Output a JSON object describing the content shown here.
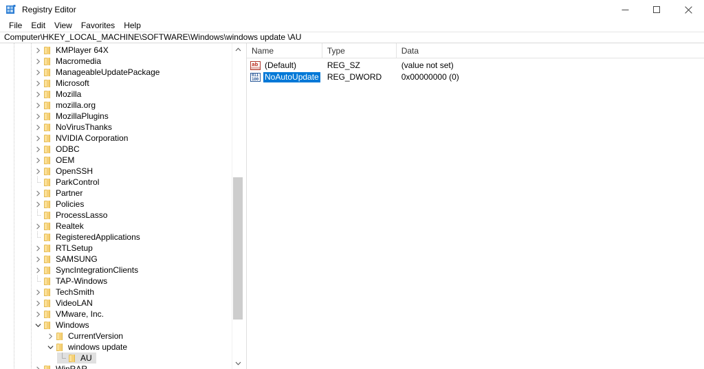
{
  "window": {
    "title": "Registry Editor",
    "icon": "registry-editor-icon",
    "controls": {
      "minimize": "minimize-icon",
      "maximize": "maximize-icon",
      "close": "close-icon"
    }
  },
  "menubar": {
    "items": [
      {
        "label": "File"
      },
      {
        "label": "Edit"
      },
      {
        "label": "View"
      },
      {
        "label": "Favorites"
      },
      {
        "label": "Help"
      }
    ]
  },
  "address": {
    "path": "Computer\\HKEY_LOCAL_MACHINE\\SOFTWARE\\Windows\\windows update \\AU"
  },
  "tree": {
    "scrollbar": {
      "up_icon": "chevron-up-icon",
      "down_icon": "chevron-down-icon",
      "thumb_top_pct": 40.5,
      "thumb_height_pct": 47.0
    },
    "nodes": [
      {
        "label": "KMPlayer 64X",
        "depth": 0,
        "expander": "collapsed",
        "selected": false
      },
      {
        "label": "Macromedia",
        "depth": 0,
        "expander": "collapsed",
        "selected": false
      },
      {
        "label": "ManageableUpdatePackage",
        "depth": 0,
        "expander": "collapsed",
        "selected": false
      },
      {
        "label": "Microsoft",
        "depth": 0,
        "expander": "collapsed",
        "selected": false
      },
      {
        "label": "Mozilla",
        "depth": 0,
        "expander": "collapsed",
        "selected": false
      },
      {
        "label": "mozilla.org",
        "depth": 0,
        "expander": "collapsed",
        "selected": false
      },
      {
        "label": "MozillaPlugins",
        "depth": 0,
        "expander": "collapsed",
        "selected": false
      },
      {
        "label": "NoVirusThanks",
        "depth": 0,
        "expander": "collapsed",
        "selected": false
      },
      {
        "label": "NVIDIA Corporation",
        "depth": 0,
        "expander": "collapsed",
        "selected": false
      },
      {
        "label": "ODBC",
        "depth": 0,
        "expander": "collapsed",
        "selected": false
      },
      {
        "label": "OEM",
        "depth": 0,
        "expander": "collapsed",
        "selected": false
      },
      {
        "label": "OpenSSH",
        "depth": 0,
        "expander": "collapsed",
        "selected": false
      },
      {
        "label": "ParkControl",
        "depth": 0,
        "expander": "leaf",
        "selected": false
      },
      {
        "label": "Partner",
        "depth": 0,
        "expander": "collapsed",
        "selected": false
      },
      {
        "label": "Policies",
        "depth": 0,
        "expander": "collapsed",
        "selected": false
      },
      {
        "label": "ProcessLasso",
        "depth": 0,
        "expander": "leaf",
        "selected": false
      },
      {
        "label": "Realtek",
        "depth": 0,
        "expander": "collapsed",
        "selected": false
      },
      {
        "label": "RegisteredApplications",
        "depth": 0,
        "expander": "leaf",
        "selected": false
      },
      {
        "label": "RTLSetup",
        "depth": 0,
        "expander": "collapsed",
        "selected": false
      },
      {
        "label": "SAMSUNG",
        "depth": 0,
        "expander": "collapsed",
        "selected": false
      },
      {
        "label": "SyncIntegrationClients",
        "depth": 0,
        "expander": "collapsed",
        "selected": false
      },
      {
        "label": "TAP-Windows",
        "depth": 0,
        "expander": "leaf",
        "selected": false
      },
      {
        "label": "TechSmith",
        "depth": 0,
        "expander": "collapsed",
        "selected": false
      },
      {
        "label": "VideoLAN",
        "depth": 0,
        "expander": "collapsed",
        "selected": false
      },
      {
        "label": "VMware, Inc.",
        "depth": 0,
        "expander": "collapsed",
        "selected": false
      },
      {
        "label": "Windows",
        "depth": 0,
        "expander": "expanded",
        "selected": false
      },
      {
        "label": "CurrentVersion",
        "depth": 1,
        "expander": "collapsed",
        "selected": false
      },
      {
        "label": "windows update",
        "depth": 1,
        "expander": "expanded",
        "selected": false
      },
      {
        "label": "AU",
        "depth": 2,
        "expander": "leaf-solid",
        "selected": true
      },
      {
        "label": "WinRAR",
        "depth": 0,
        "expander": "collapsed",
        "selected": false
      }
    ]
  },
  "values": {
    "columns": [
      {
        "label": "Name"
      },
      {
        "label": "Type"
      },
      {
        "label": "Data"
      }
    ],
    "rows": [
      {
        "icon": "string-value-icon",
        "name": "(Default)",
        "type": "REG_SZ",
        "data": "(value not set)",
        "selected": false
      },
      {
        "icon": "dword-value-icon",
        "name": "NoAutoUpdate",
        "type": "REG_DWORD",
        "data": "0x00000000 (0)",
        "selected": true
      }
    ]
  },
  "colors": {
    "selection_blue": "#0078d7",
    "tree_selection_gray": "#e0e0e0",
    "folder_yellow": "#fbe19a",
    "accent_icon_blue": "#2e5c9a",
    "string_icon_red": "#c0392b"
  }
}
